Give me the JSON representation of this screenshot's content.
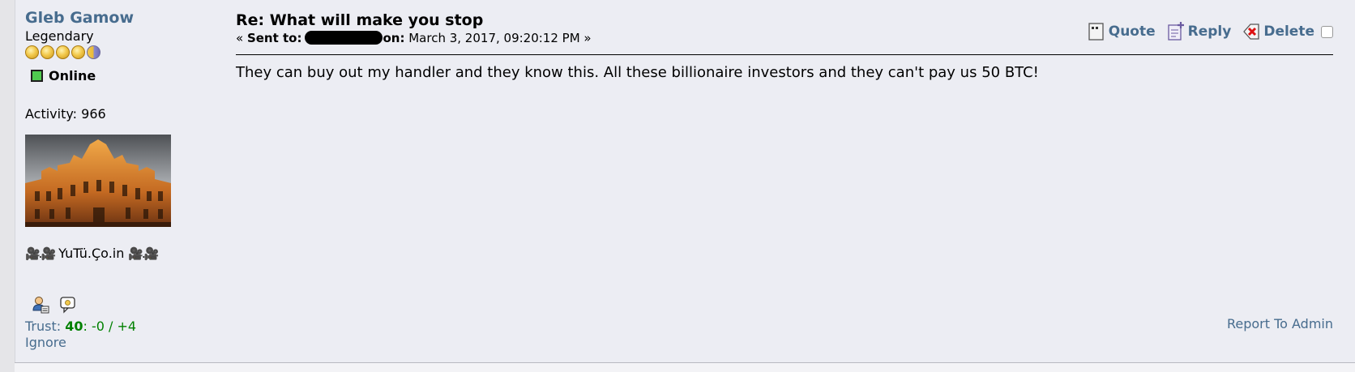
{
  "poster": {
    "name": "Gleb Gamow",
    "rank": "Legendary",
    "stars": 5,
    "status": "Online",
    "activity": "Activity: 966",
    "signature_text": "YuTü.Ço.in",
    "trust": {
      "label": "Trust: ",
      "score": "40",
      "detail": ": -0 / +4"
    },
    "ignore_label": "Ignore"
  },
  "message": {
    "subject": "Re: What will make you stop",
    "meta_prefix": "« ",
    "sent_to_label": "Sent to:",
    "on_label": "on:",
    "date": " March 3, 2017, 09:20:12 PM »",
    "body": "They can buy out my handler and they know this. All these billionaire investors and they can't pay us 50 BTC!"
  },
  "actions": {
    "quote": "Quote",
    "reply": "Reply",
    "delete": "Delete"
  },
  "footer": {
    "report": "Report To Admin"
  },
  "colors": {
    "link": "#476c8e",
    "trust_good": "#008000",
    "online": "#4fcb4f",
    "background": "#ecedf3"
  }
}
